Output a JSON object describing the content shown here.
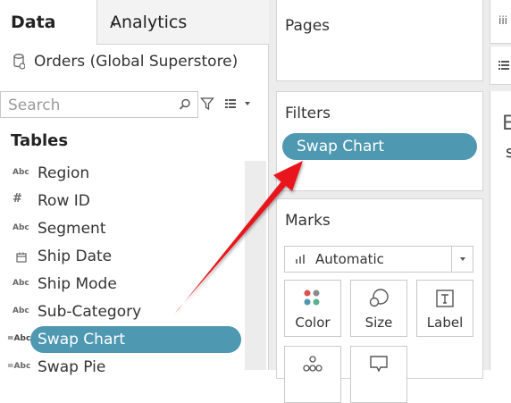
{
  "tabs": {
    "data": "Data",
    "analytics": "Analytics",
    "collapse": "‹"
  },
  "datasource": {
    "name": "Orders (Global Superstore)"
  },
  "search": {
    "placeholder": "Search"
  },
  "tables_heading": "Tables",
  "fields": [
    {
      "type": "Abc",
      "label": "Region"
    },
    {
      "type": "#",
      "label": "Row ID"
    },
    {
      "type": "Abc",
      "label": "Segment"
    },
    {
      "type": "date",
      "label": "Ship Date"
    },
    {
      "type": "Abc",
      "label": "Ship Mode"
    },
    {
      "type": "Abc",
      "label": "Sub-Category"
    },
    {
      "type": "=Abc",
      "label": "Swap Chart",
      "selected": true
    },
    {
      "type": "=Abc",
      "label": "Swap Pie"
    }
  ],
  "shelves": {
    "pages": "Pages",
    "filters": "Filters",
    "filter_pill": "Swap Chart",
    "marks": "Marks",
    "mark_type": "Automatic",
    "mark_buttons": {
      "color": "Color",
      "size": "Size",
      "label": "Label"
    }
  },
  "right_partial": {
    "top": "iii",
    "letter1": "E",
    "letter2": "s"
  },
  "colors": {
    "pill": "#4e98b1",
    "arrow": "#e8191b",
    "pane_bg": "#ececec"
  }
}
